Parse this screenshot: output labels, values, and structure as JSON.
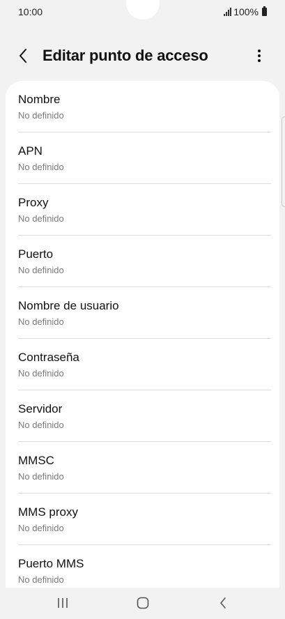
{
  "status_bar": {
    "time": "10:00",
    "battery": "100%"
  },
  "header": {
    "title": "Editar punto de acceso",
    "back_icon": "chevron-left-icon",
    "more_icon": "more-vertical-icon"
  },
  "settings": [
    {
      "title": "Nombre",
      "value": "No definido"
    },
    {
      "title": "APN",
      "value": "No definido"
    },
    {
      "title": "Proxy",
      "value": "No definido"
    },
    {
      "title": "Puerto",
      "value": "No definido"
    },
    {
      "title": "Nombre de usuario",
      "value": "No definido"
    },
    {
      "title": "Contraseña",
      "value": "No definido"
    },
    {
      "title": "Servidor",
      "value": "No definido"
    },
    {
      "title": "MMSC",
      "value": "No definido"
    },
    {
      "title": "MMS proxy",
      "value": "No definido"
    },
    {
      "title": "Puerto MMS",
      "value": "No definido"
    }
  ],
  "nav_bar": {
    "recents_icon": "recents-icon",
    "home_icon": "home-icon",
    "back_icon": "back-icon"
  }
}
